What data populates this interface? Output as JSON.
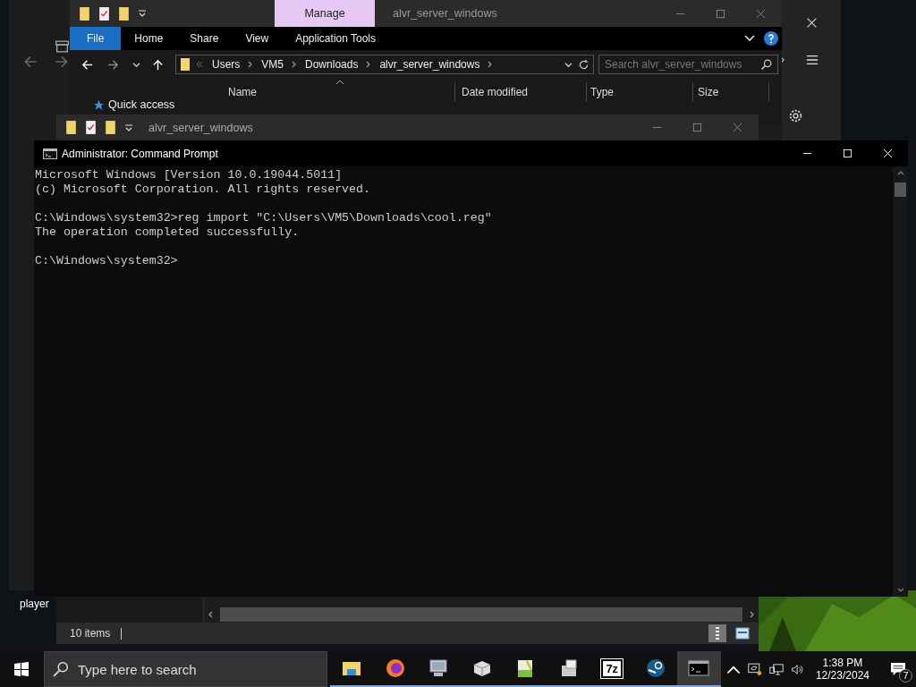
{
  "desktop": {
    "icons": [
      {
        "label": "player"
      }
    ]
  },
  "explorer_back": {
    "title": "alvr_server_windows",
    "context_tab": "Manage",
    "ribbon_tabs": [
      {
        "label": "File",
        "selected": true
      },
      {
        "label": "Home",
        "selected": false
      },
      {
        "label": "Share",
        "selected": false
      },
      {
        "label": "View",
        "selected": false
      },
      {
        "label": "Application Tools",
        "selected": false
      }
    ],
    "breadcrumb": [
      "Users",
      "VM5",
      "Downloads",
      "alvr_server_windows"
    ],
    "search": {
      "placeholder": "Search alvr_server_windows"
    },
    "nav": [
      {
        "label": "Quick access"
      }
    ],
    "columns": [
      "Name",
      "Date modified",
      "Type",
      "Size"
    ]
  },
  "explorer_front": {
    "title": "alvr_server_windows",
    "status": "10 items"
  },
  "cmd": {
    "title": "Administrator: Command Prompt",
    "paragraphs": [
      [
        "Microsoft Windows [Version 10.0.19044.5011]",
        "(c) Microsoft Corporation. All rights reserved."
      ],
      [
        "C:\\Windows\\system32>reg import \"C:\\Users\\VM5\\Downloads\\cool.reg\"",
        "The operation completed successfully."
      ],
      [
        "C:\\Windows\\system32>"
      ]
    ]
  },
  "taskbar": {
    "search": {
      "placeholder": "Type here to search"
    },
    "apps": [
      {
        "kind": "explorer",
        "active": false
      },
      {
        "kind": "firefox",
        "active": false
      },
      {
        "kind": "computer",
        "active": false
      },
      {
        "kind": "box",
        "active": false
      },
      {
        "kind": "notepad",
        "active": false
      },
      {
        "kind": "package",
        "active": false
      },
      {
        "kind": "archiver",
        "label": "7z",
        "active": false
      },
      {
        "kind": "steam",
        "active": false
      },
      {
        "kind": "terminal",
        "active": true
      }
    ],
    "time": "1:38 PM",
    "date": "12/23/2024",
    "notifications": "7"
  }
}
